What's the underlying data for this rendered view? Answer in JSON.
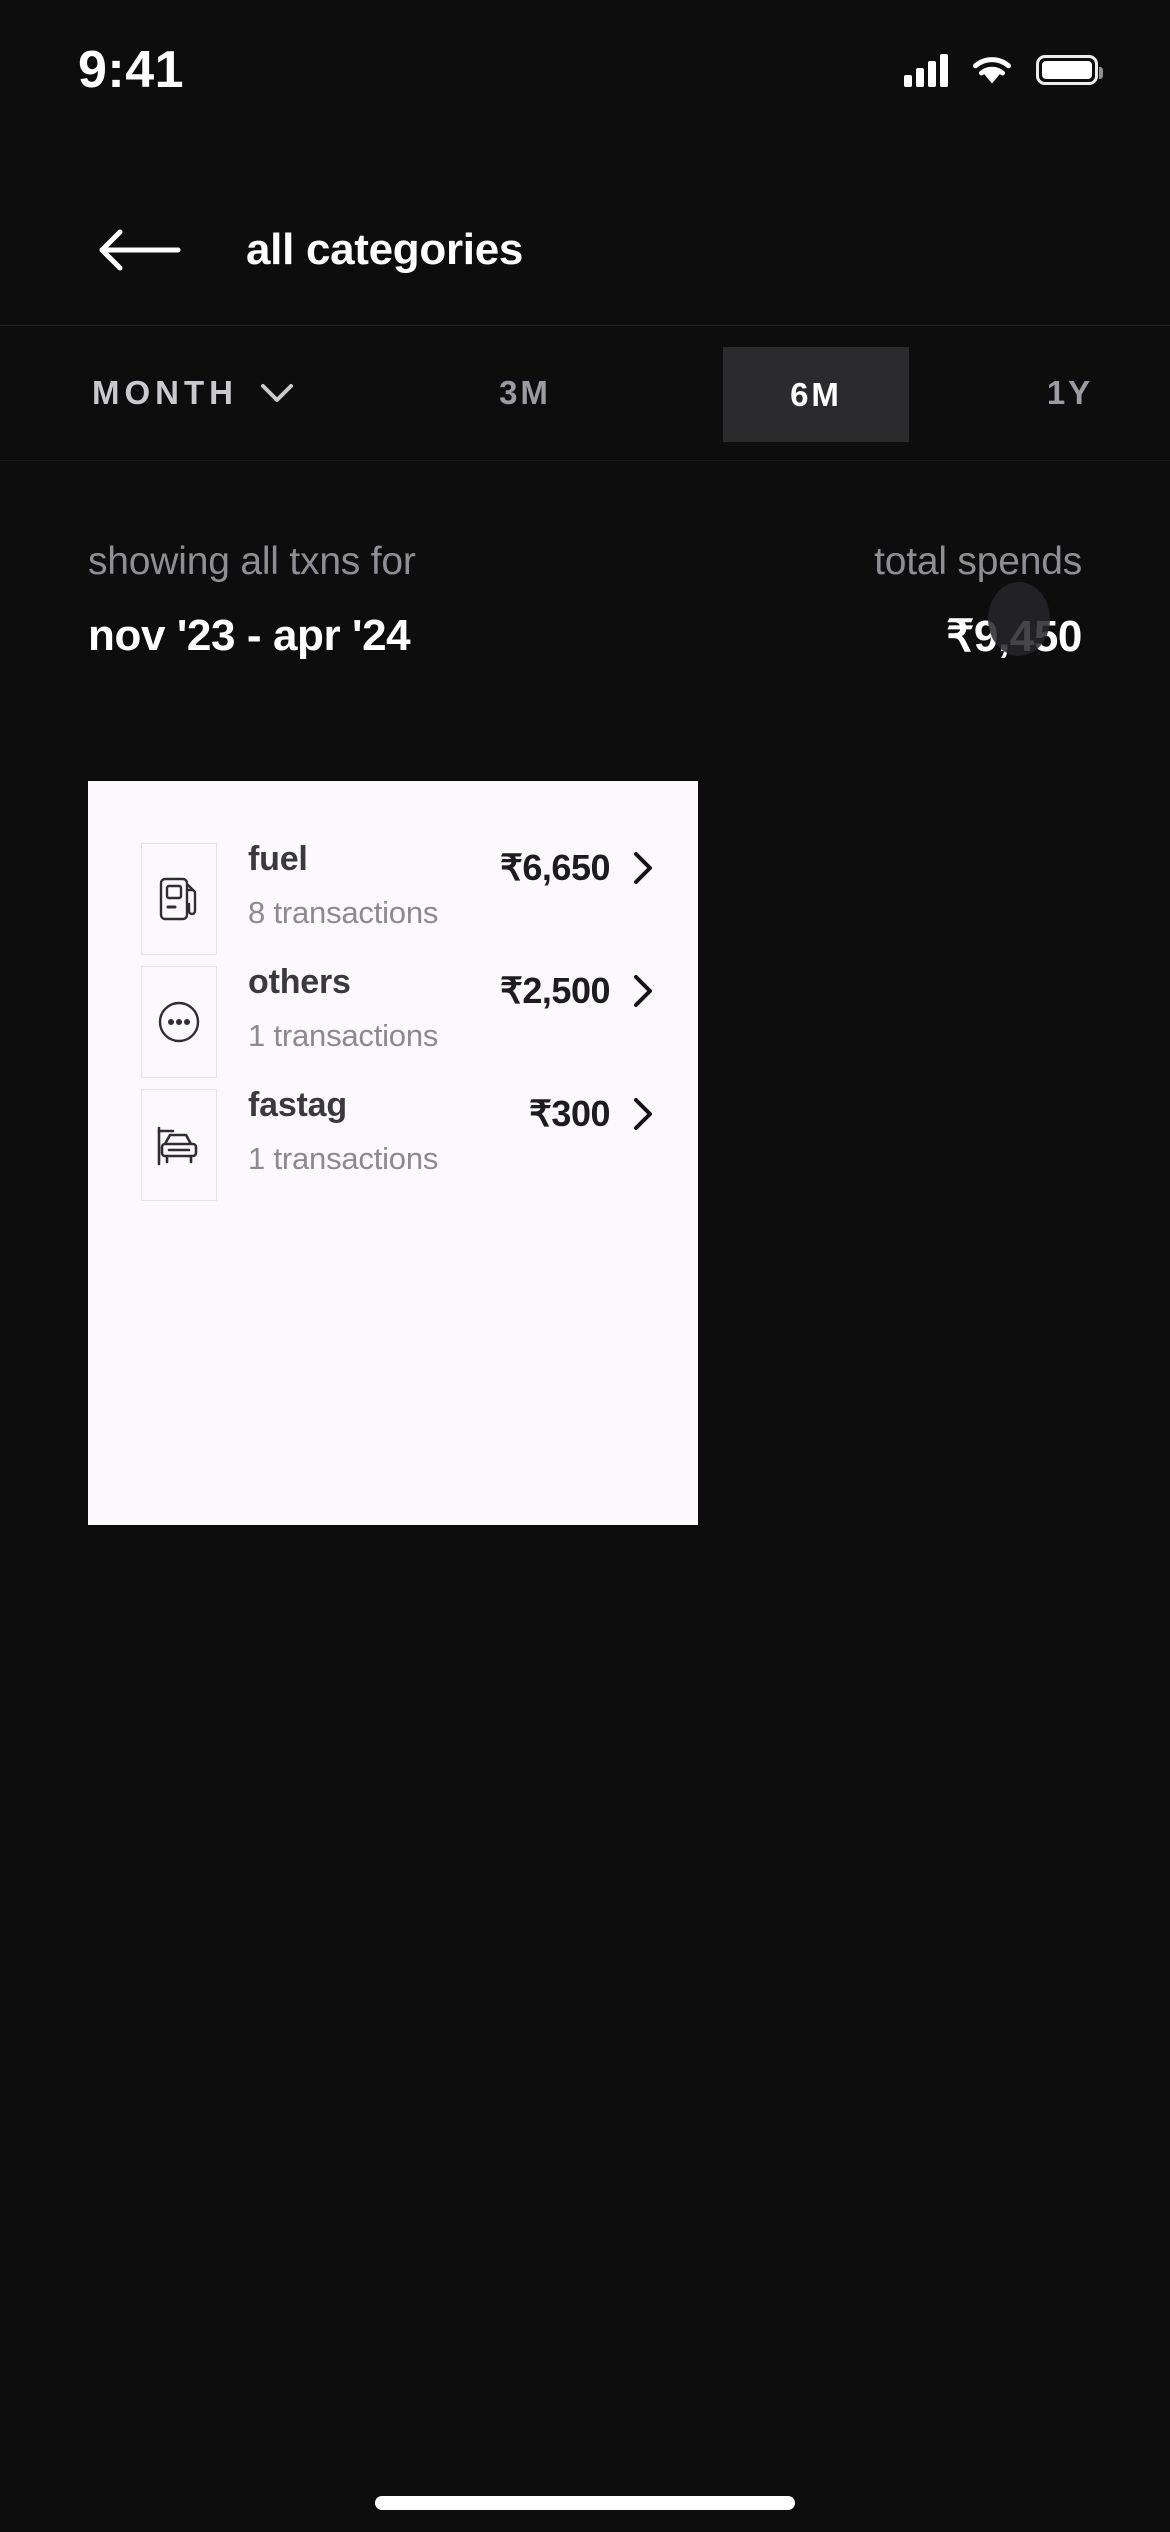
{
  "status_bar": {
    "time": "9:41",
    "icons": [
      "cellular-signal-icon",
      "wifi-icon",
      "battery-icon"
    ]
  },
  "nav": {
    "back_icon": "back-arrow-icon",
    "title": "all categories"
  },
  "filters": {
    "month_label": "MONTH",
    "month_chevron_icon": "chevron-down-icon",
    "ranges": [
      {
        "label": "3M",
        "selected": false
      },
      {
        "label": "6M",
        "selected": true
      },
      {
        "label": "1Y",
        "selected": false
      }
    ],
    "selected_range": "6M",
    "selected_bg": "#2b2b2d"
  },
  "summary": {
    "showing_label": "showing all txns for",
    "period": "nov '23 - apr '24",
    "total_label": "total spends",
    "total_value": "₹9,450"
  },
  "card": {
    "background": "#fbf9fc",
    "rows": [
      {
        "icon": "fuel-pump-icon",
        "name": "fuel",
        "transactions": "8 transactions",
        "amount": "₹6,650",
        "chevron": "chevron-right-icon"
      },
      {
        "icon": "three-dots-circle-icon",
        "name": "others",
        "transactions": "1 transactions",
        "amount": "₹2,500",
        "chevron": "chevron-right-icon"
      },
      {
        "icon": "car-toll-gantry-icon",
        "name": "fastag",
        "transactions": "1 transactions",
        "amount": "₹300",
        "chevron": "chevron-right-icon"
      }
    ]
  },
  "theme": {
    "background": "#0d0d0e",
    "text_primary": "#ffffff",
    "text_muted": "#8e8e95"
  }
}
